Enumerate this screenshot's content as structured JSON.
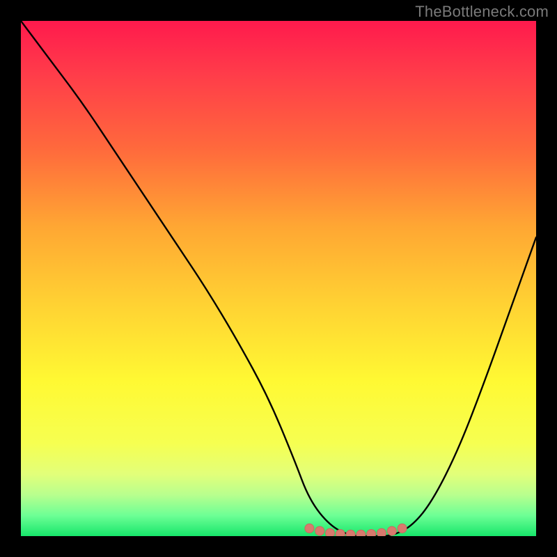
{
  "watermark": "TheBottleneck.com",
  "chart_data": {
    "type": "line",
    "title": "",
    "xlabel": "",
    "ylabel": "",
    "xlim": [
      0,
      100
    ],
    "ylim": [
      0,
      100
    ],
    "grid": false,
    "legend": false,
    "background_gradient": {
      "direction": "vertical",
      "stops": [
        {
          "pos": 0.0,
          "color": "#ff1a4d"
        },
        {
          "pos": 0.25,
          "color": "#ff6a3c"
        },
        {
          "pos": 0.55,
          "color": "#ffd233"
        },
        {
          "pos": 0.82,
          "color": "#f6ff51"
        },
        {
          "pos": 0.96,
          "color": "#6dff95"
        },
        {
          "pos": 1.0,
          "color": "#17e66b"
        }
      ]
    },
    "series": [
      {
        "name": "bottleneck-curve",
        "color": "#000000",
        "x": [
          0,
          6,
          12,
          18,
          24,
          30,
          36,
          42,
          48,
          53,
          56,
          60,
          64,
          68,
          72,
          76,
          80,
          85,
          90,
          95,
          100
        ],
        "y": [
          100,
          92,
          84,
          75,
          66,
          57,
          48,
          38,
          27,
          15,
          7,
          2,
          0,
          0,
          0,
          2,
          7,
          17,
          30,
          44,
          58
        ]
      }
    ],
    "markers": {
      "name": "optimal-range",
      "color": "#d87a6e",
      "x": [
        56,
        58,
        60,
        62,
        64,
        66,
        68,
        70,
        72,
        74
      ],
      "y": [
        1.5,
        1.0,
        0.6,
        0.4,
        0.3,
        0.3,
        0.4,
        0.6,
        1.0,
        1.5
      ]
    }
  }
}
